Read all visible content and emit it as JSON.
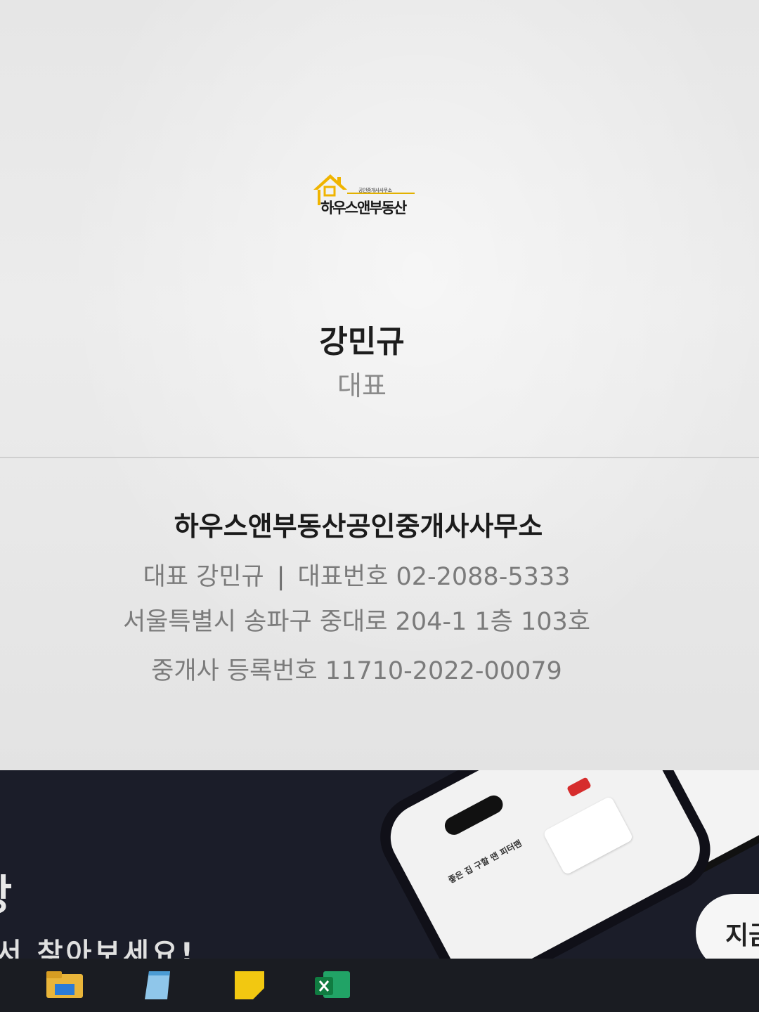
{
  "logo": {
    "tagline": "공인중개사사무소",
    "name": "하우스앤부동산",
    "accent_color": "#e2b100"
  },
  "agent": {
    "name": "강민규",
    "role": "대표"
  },
  "company": {
    "name": "하우스앤부동산공인중개사사무소",
    "rep_label": "대표 강민규",
    "separator": "|",
    "phone_label": "대표번호 02-2088-5333",
    "address": "서울특별시 송파구 중대로 204-1 1층 103호",
    "registration": "중개사 등록번호 11710-2022-00079"
  },
  "banner": {
    "title_fragment": "방",
    "subtitle_fragment": "서 찾아보세요!",
    "cta_fragment": "지금",
    "phone_headline": "좋은 집 구할 땐 피터팬",
    "background_color": "#1b1d29"
  },
  "taskbar": {
    "icons": [
      "file-explorer-icon",
      "notepad-icon",
      "sticky-notes-icon",
      "excel-icon"
    ]
  }
}
